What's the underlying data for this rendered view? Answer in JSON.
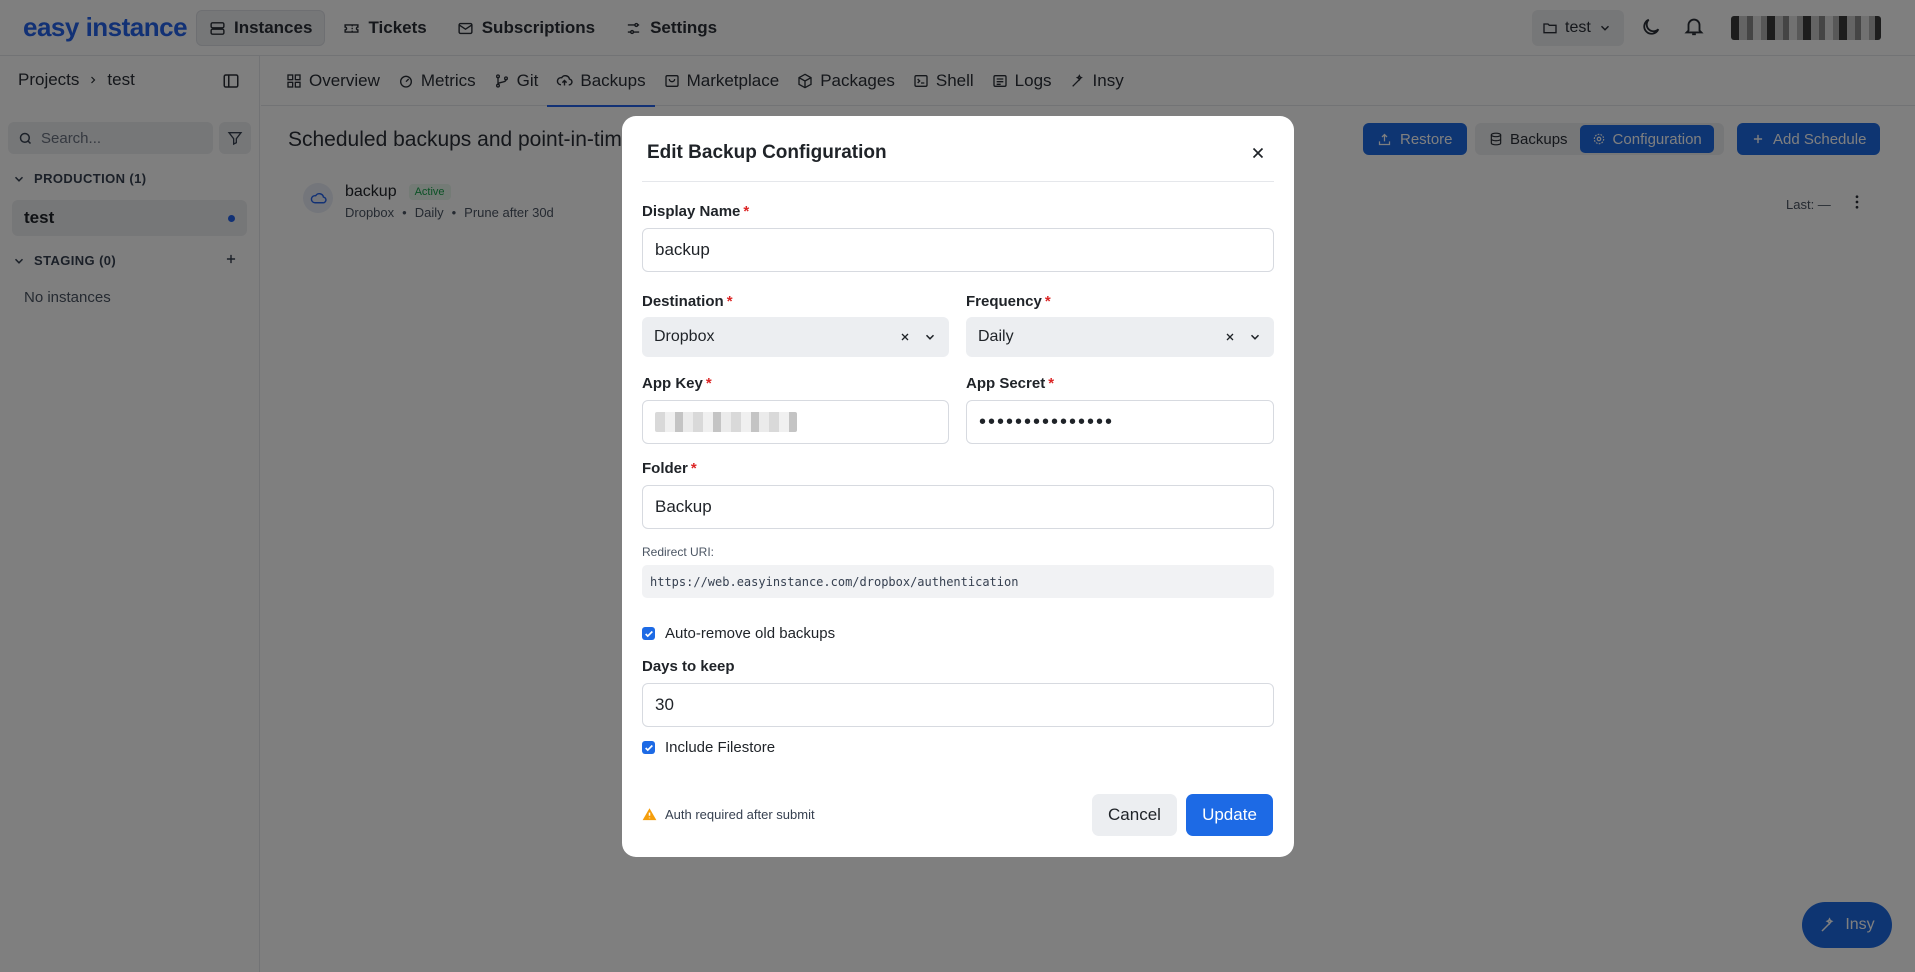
{
  "app": {
    "logo": "easy instance"
  },
  "topnav": {
    "items": [
      {
        "label": "Instances",
        "icon": "server-icon"
      },
      {
        "label": "Tickets",
        "icon": "ticket-icon"
      },
      {
        "label": "Subscriptions",
        "icon": "mail-icon"
      },
      {
        "label": "Settings",
        "icon": "sliders-icon"
      }
    ]
  },
  "project_selector": {
    "value": "test"
  },
  "breadcrumb": {
    "root": "Projects",
    "current": "test"
  },
  "sidebar": {
    "search_placeholder": "Search...",
    "production_label": "PRODUCTION (1)",
    "instance_name": "test",
    "staging_label": "STAGING (0)",
    "no_instances": "No instances"
  },
  "tabs": [
    {
      "label": "Overview",
      "icon": "grid-icon"
    },
    {
      "label": "Metrics",
      "icon": "gauge-icon"
    },
    {
      "label": "Git",
      "icon": "git-icon"
    },
    {
      "label": "Backups",
      "icon": "cloud-upload-icon"
    },
    {
      "label": "Marketplace",
      "icon": "store-icon"
    },
    {
      "label": "Packages",
      "icon": "package-icon"
    },
    {
      "label": "Shell",
      "icon": "terminal-icon"
    },
    {
      "label": "Logs",
      "icon": "logs-icon"
    },
    {
      "label": "Insy",
      "icon": "wand-icon"
    }
  ],
  "active_tab": "Backups",
  "page": {
    "title": "Scheduled backups and point-in-tim"
  },
  "actions": {
    "restore": "Restore",
    "backups": "Backups",
    "configuration": "Configuration",
    "add_schedule": "Add Schedule"
  },
  "backup_row": {
    "name": "backup",
    "status": "Active",
    "meta": [
      "Dropbox",
      "Daily",
      "Prune after 30d"
    ],
    "last": "Last: —"
  },
  "modal": {
    "title": "Edit Backup Configuration",
    "display_name_label": "Display Name",
    "display_name_value": "backup",
    "destination_label": "Destination",
    "destination_value": "Dropbox",
    "frequency_label": "Frequency",
    "frequency_value": "Daily",
    "app_key_label": "App Key",
    "app_secret_label": "App Secret",
    "app_secret_value": "•••••••••••••••",
    "folder_label": "Folder",
    "folder_value": "Backup",
    "redirect_label": "Redirect URI:",
    "redirect_value": "https://web.easyinstance.com/dropbox/authentication",
    "auto_remove_label": "Auto-remove old backups",
    "auto_remove_checked": true,
    "days_label": "Days to keep",
    "days_value": "30",
    "include_filestore_label": "Include Filestore",
    "include_filestore_checked": true,
    "warning": "Auth required after submit",
    "cancel": "Cancel",
    "update": "Update"
  },
  "fab": {
    "label": "Insy"
  },
  "colors": {
    "accent": "#1d6ae5",
    "brand": "#2563eb",
    "required": "#dc2626",
    "warning": "#f59e0b",
    "success": "#16a34a"
  }
}
